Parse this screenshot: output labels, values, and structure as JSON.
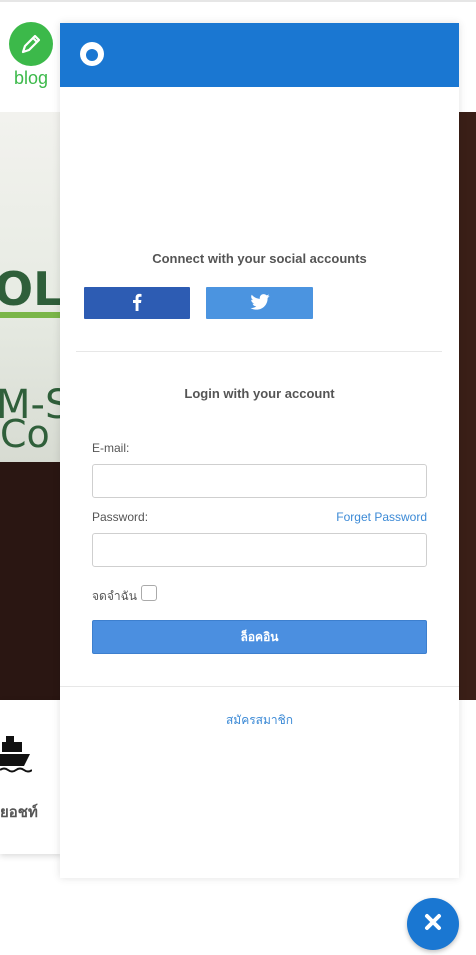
{
  "background": {
    "blog_logo_text": "blog",
    "banner_text_1": "OL",
    "banner_text_2": "M-S",
    "banner_text_3": "Co",
    "card_label": "ยอชท์"
  },
  "panel": {
    "social_title": "Connect with your social accounts",
    "facebook_icon": "facebook-icon",
    "twitter_icon": "twitter-icon",
    "login_title": "Login with your account",
    "email_label": "E-mail:",
    "email_value": "",
    "password_label": "Password:",
    "password_value": "",
    "forget_password": "Forget Password",
    "remember_label": "จดจำฉัน",
    "remember_checked": false,
    "login_button": "ล็อคอิน",
    "register_link": "สมัครสมาชิก"
  },
  "colors": {
    "header_blue": "#1a77d2",
    "facebook": "#2d5cb3",
    "twitter": "#4b94e0",
    "login_button": "#4b8fe0",
    "link": "#3c8ad6",
    "blog_green": "#3cb94a"
  }
}
